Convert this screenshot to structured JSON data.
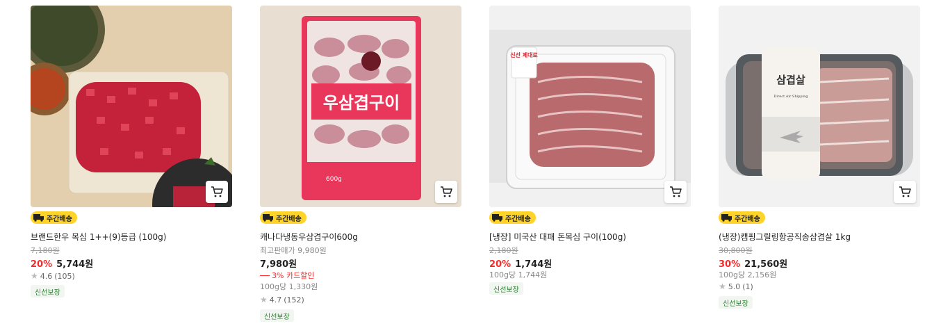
{
  "badge_label": "주간배송",
  "fresh_label": "신선보장",
  "products": [
    {
      "title": "브랜드한우 목심 1++(9)등급 (100g)",
      "original_price": "7,180원",
      "discount": "20%",
      "price": "5,744원",
      "rating": "4.6",
      "reviews": "(105)"
    },
    {
      "title": "캐나다냉동우삼겹구이600g",
      "lowest_price": "최고판매가 9,980원",
      "price": "7,980원",
      "card_discount": "3% 카드할인",
      "unit_price": "100g당 1,330원",
      "rating": "4.7",
      "reviews": "(152)",
      "package_text": "우삼겹구이",
      "package_weight": "600g"
    },
    {
      "title": "[냉장] 미국산 대패 돈목심 구이(100g)",
      "original_price": "2,180원",
      "discount": "20%",
      "price": "1,744원",
      "unit_price": "100g당 1,744원",
      "sticker_text": "신선 제대로"
    },
    {
      "title": "(냉장)캠핑그릴링항공직송삼겹살 1kg",
      "original_price": "30,800원",
      "discount": "30%",
      "price": "21,560원",
      "unit_price": "100g당 2,156원",
      "rating": "5.0",
      "reviews": "(1)",
      "label_title": "삼겹살",
      "label_sub": "Direct Air Shipping"
    }
  ],
  "colors": {
    "accent_red": "#fa2828",
    "badge_yellow": "#ffd42a",
    "fresh_green": "#2e7d32"
  }
}
